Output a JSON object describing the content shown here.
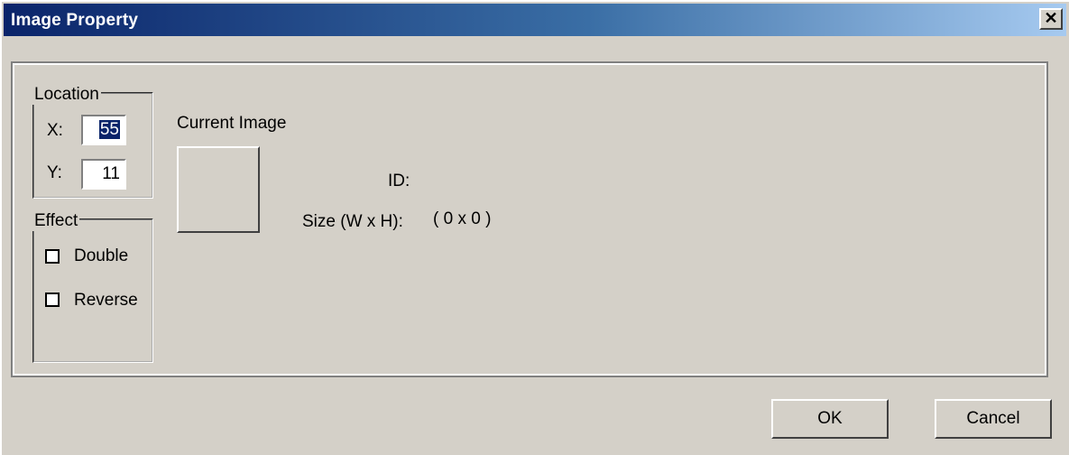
{
  "window": {
    "title": "Image Property",
    "close_glyph": "✕"
  },
  "location": {
    "legend": "Location",
    "x_label": "X:",
    "x_value": "55",
    "y_label": "Y:",
    "y_value": "11"
  },
  "effect": {
    "legend": "Effect",
    "double_label": "Double",
    "double_checked": false,
    "reverse_label": "Reverse",
    "reverse_checked": false
  },
  "current_image": {
    "label": "Current Image",
    "id_label": "ID:",
    "id_value": "",
    "size_label": "Size (W x H):",
    "size_value": "( 0 x 0 )"
  },
  "buttons": {
    "ok_label": "OK",
    "cancel_label": "Cancel"
  }
}
